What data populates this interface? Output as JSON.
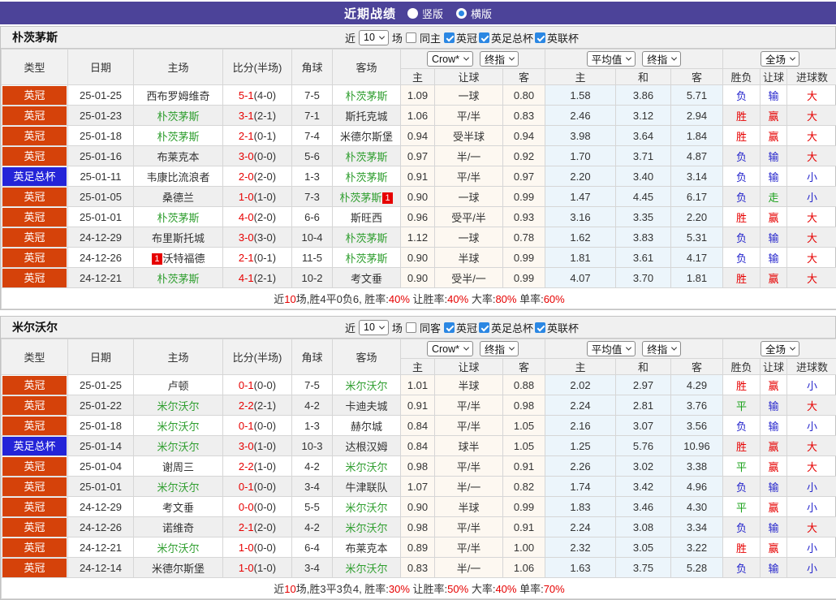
{
  "topbar": {
    "title": "近期战绩",
    "radios": [
      {
        "label": "竖版",
        "checked": false
      },
      {
        "label": "横版",
        "checked": true
      }
    ]
  },
  "colors": {
    "topbar_bg": "#4c4399",
    "league_championship": "#d5420a",
    "league_facup": "#2424d8",
    "team_highlight": "#2f9e2f",
    "win_red": "#e60000",
    "lose_blue": "#2525cc",
    "draw_green": "#18a018",
    "crow_col_bg": "#fdf8f1",
    "avg_col_bg": "#ecf5fb",
    "checkbox_blue": "#2b87e3"
  },
  "filter_labels": {
    "near": "近",
    "count": "10",
    "games": "场"
  },
  "header": {
    "static_cols": [
      "类型",
      "日期",
      "主场",
      "比分(半场)",
      "角球",
      "客场"
    ],
    "dropdown_crow": "Crow*",
    "dropdown_crow_final": "终指",
    "crow_cols": [
      "主",
      "让球",
      "客"
    ],
    "dropdown_avg": "平均值",
    "dropdown_avg_final": "终指",
    "avg_cols": [
      "主",
      "和",
      "客"
    ],
    "dropdown_scope": "全场",
    "result_cols": [
      "胜负",
      "让球",
      "进球数"
    ]
  },
  "tables": [
    {
      "team": "朴茨茅斯",
      "filters": {
        "same_label": "同主",
        "same_checked": false,
        "leagues": [
          {
            "label": "英冠",
            "checked": true
          },
          {
            "label": "英足总杯",
            "checked": true
          },
          {
            "label": "英联杯",
            "checked": true
          }
        ]
      },
      "rows": [
        {
          "type": "英冠",
          "type_style": "orange",
          "date": "25-01-25",
          "home": {
            "name": "西布罗姆维奇",
            "green": false
          },
          "score": "5-1",
          "half": "(4-0)",
          "corners": "7-5",
          "away": {
            "name": "朴茨茅斯",
            "green": true
          },
          "crow": [
            "1.09",
            "一球",
            "0.80"
          ],
          "avg": [
            "1.58",
            "3.86",
            "5.71"
          ],
          "res": [
            [
              "负",
              "b"
            ],
            [
              "输",
              "b"
            ],
            [
              "大",
              "r"
            ]
          ]
        },
        {
          "type": "英冠",
          "type_style": "orange",
          "date": "25-01-23",
          "home": {
            "name": "朴茨茅斯",
            "green": true
          },
          "score": "3-1",
          "half": "(2-1)",
          "corners": "7-1",
          "away": {
            "name": "斯托克城",
            "green": false
          },
          "crow": [
            "1.06",
            "平/半",
            "0.83"
          ],
          "avg": [
            "2.46",
            "3.12",
            "2.94"
          ],
          "res": [
            [
              "胜",
              "r"
            ],
            [
              "赢",
              "r"
            ],
            [
              "大",
              "r"
            ]
          ]
        },
        {
          "type": "英冠",
          "type_style": "orange",
          "date": "25-01-18",
          "home": {
            "name": "朴茨茅斯",
            "green": true
          },
          "score": "2-1",
          "half": "(0-1)",
          "corners": "7-4",
          "away": {
            "name": "米德尔斯堡",
            "green": false
          },
          "crow": [
            "0.94",
            "受半球",
            "0.94"
          ],
          "avg": [
            "3.98",
            "3.64",
            "1.84"
          ],
          "res": [
            [
              "胜",
              "r"
            ],
            [
              "赢",
              "r"
            ],
            [
              "大",
              "r"
            ]
          ]
        },
        {
          "type": "英冠",
          "type_style": "orange",
          "date": "25-01-16",
          "home": {
            "name": "布莱克本",
            "green": false
          },
          "score": "3-0",
          "half": "(0-0)",
          "corners": "5-6",
          "away": {
            "name": "朴茨茅斯",
            "green": true
          },
          "crow": [
            "0.97",
            "半/一",
            "0.92"
          ],
          "avg": [
            "1.70",
            "3.71",
            "4.87"
          ],
          "res": [
            [
              "负",
              "b"
            ],
            [
              "输",
              "b"
            ],
            [
              "大",
              "r"
            ]
          ]
        },
        {
          "type": "英足总杯",
          "type_style": "blue",
          "date": "25-01-11",
          "home": {
            "name": "韦康比流浪者",
            "green": false
          },
          "score": "2-0",
          "half": "(2-0)",
          "corners": "1-3",
          "away": {
            "name": "朴茨茅斯",
            "green": true
          },
          "crow": [
            "0.91",
            "平/半",
            "0.97"
          ],
          "avg": [
            "2.20",
            "3.40",
            "3.14"
          ],
          "res": [
            [
              "负",
              "b"
            ],
            [
              "输",
              "b"
            ],
            [
              "小",
              "b"
            ]
          ]
        },
        {
          "type": "英冠",
          "type_style": "orange",
          "date": "25-01-05",
          "home": {
            "name": "桑德兰",
            "green": false
          },
          "score": "1-0",
          "half": "(1-0)",
          "corners": "7-3",
          "away": {
            "name": "朴茨茅斯",
            "green": true,
            "badge_post": "1"
          },
          "crow": [
            "0.90",
            "一球",
            "0.99"
          ],
          "avg": [
            "1.47",
            "4.45",
            "6.17"
          ],
          "res": [
            [
              "负",
              "b"
            ],
            [
              "走",
              "g"
            ],
            [
              "小",
              "b"
            ]
          ]
        },
        {
          "type": "英冠",
          "type_style": "orange",
          "date": "25-01-01",
          "home": {
            "name": "朴茨茅斯",
            "green": true
          },
          "score": "4-0",
          "half": "(2-0)",
          "corners": "6-6",
          "away": {
            "name": "斯旺西",
            "green": false
          },
          "crow": [
            "0.96",
            "受平/半",
            "0.93"
          ],
          "avg": [
            "3.16",
            "3.35",
            "2.20"
          ],
          "res": [
            [
              "胜",
              "r"
            ],
            [
              "赢",
              "r"
            ],
            [
              "大",
              "r"
            ]
          ]
        },
        {
          "type": "英冠",
          "type_style": "orange",
          "date": "24-12-29",
          "home": {
            "name": "布里斯托城",
            "green": false
          },
          "score": "3-0",
          "half": "(3-0)",
          "corners": "10-4",
          "away": {
            "name": "朴茨茅斯",
            "green": true
          },
          "crow": [
            "1.12",
            "一球",
            "0.78"
          ],
          "avg": [
            "1.62",
            "3.83",
            "5.31"
          ],
          "res": [
            [
              "负",
              "b"
            ],
            [
              "输",
              "b"
            ],
            [
              "大",
              "r"
            ]
          ]
        },
        {
          "type": "英冠",
          "type_style": "orange",
          "date": "24-12-26",
          "home": {
            "name": "沃特福德",
            "green": false,
            "badge_pre": "1"
          },
          "score": "2-1",
          "half": "(0-1)",
          "corners": "11-5",
          "away": {
            "name": "朴茨茅斯",
            "green": true
          },
          "crow": [
            "0.90",
            "半球",
            "0.99"
          ],
          "avg": [
            "1.81",
            "3.61",
            "4.17"
          ],
          "res": [
            [
              "负",
              "b"
            ],
            [
              "输",
              "b"
            ],
            [
              "大",
              "r"
            ]
          ]
        },
        {
          "type": "英冠",
          "type_style": "orange",
          "date": "24-12-21",
          "home": {
            "name": "朴茨茅斯",
            "green": true
          },
          "score": "4-1",
          "half": "(2-1)",
          "corners": "10-2",
          "away": {
            "name": "考文垂",
            "green": false
          },
          "crow": [
            "0.90",
            "受半/一",
            "0.99"
          ],
          "avg": [
            "4.07",
            "3.70",
            "1.81"
          ],
          "res": [
            [
              "胜",
              "r"
            ],
            [
              "赢",
              "r"
            ],
            [
              "大",
              "r"
            ]
          ]
        }
      ],
      "summary": [
        [
          "近",
          0
        ],
        [
          "10",
          1
        ],
        [
          "场,胜4平0负6, 胜率:",
          0
        ],
        [
          "40%",
          1
        ],
        [
          " 让胜率:",
          0
        ],
        [
          "40%",
          1
        ],
        [
          " 大率:",
          0
        ],
        [
          "80%",
          1
        ],
        [
          " 单率:",
          0
        ],
        [
          "60%",
          1
        ]
      ]
    },
    {
      "team": "米尔沃尔",
      "filters": {
        "same_label": "同客",
        "same_checked": false,
        "leagues": [
          {
            "label": "英冠",
            "checked": true
          },
          {
            "label": "英足总杯",
            "checked": true
          },
          {
            "label": "英联杯",
            "checked": true
          }
        ]
      },
      "rows": [
        {
          "type": "英冠",
          "type_style": "orange",
          "date": "25-01-25",
          "home": {
            "name": "卢顿",
            "green": false
          },
          "score": "0-1",
          "half": "(0-0)",
          "corners": "7-5",
          "away": {
            "name": "米尔沃尔",
            "green": true
          },
          "crow": [
            "1.01",
            "半球",
            "0.88"
          ],
          "avg": [
            "2.02",
            "2.97",
            "4.29"
          ],
          "res": [
            [
              "胜",
              "r"
            ],
            [
              "赢",
              "r"
            ],
            [
              "小",
              "b"
            ]
          ]
        },
        {
          "type": "英冠",
          "type_style": "orange",
          "date": "25-01-22",
          "home": {
            "name": "米尔沃尔",
            "green": true
          },
          "score": "2-2",
          "half": "(2-1)",
          "corners": "4-2",
          "away": {
            "name": "卡迪夫城",
            "green": false
          },
          "crow": [
            "0.91",
            "平/半",
            "0.98"
          ],
          "avg": [
            "2.24",
            "2.81",
            "3.76"
          ],
          "res": [
            [
              "平",
              "g"
            ],
            [
              "输",
              "b"
            ],
            [
              "大",
              "r"
            ]
          ]
        },
        {
          "type": "英冠",
          "type_style": "orange",
          "date": "25-01-18",
          "home": {
            "name": "米尔沃尔",
            "green": true
          },
          "score": "0-1",
          "half": "(0-0)",
          "corners": "1-3",
          "away": {
            "name": "赫尔城",
            "green": false
          },
          "crow": [
            "0.84",
            "平/半",
            "1.05"
          ],
          "avg": [
            "2.16",
            "3.07",
            "3.56"
          ],
          "res": [
            [
              "负",
              "b"
            ],
            [
              "输",
              "b"
            ],
            [
              "小",
              "b"
            ]
          ]
        },
        {
          "type": "英足总杯",
          "type_style": "blue",
          "date": "25-01-14",
          "home": {
            "name": "米尔沃尔",
            "green": true
          },
          "score": "3-0",
          "half": "(1-0)",
          "corners": "10-3",
          "away": {
            "name": "达根汉姆",
            "green": false
          },
          "crow": [
            "0.84",
            "球半",
            "1.05"
          ],
          "avg": [
            "1.25",
            "5.76",
            "10.96"
          ],
          "res": [
            [
              "胜",
              "r"
            ],
            [
              "赢",
              "r"
            ],
            [
              "大",
              "r"
            ]
          ]
        },
        {
          "type": "英冠",
          "type_style": "orange",
          "date": "25-01-04",
          "home": {
            "name": "谢周三",
            "green": false
          },
          "score": "2-2",
          "half": "(1-0)",
          "corners": "4-2",
          "away": {
            "name": "米尔沃尔",
            "green": true
          },
          "crow": [
            "0.98",
            "平/半",
            "0.91"
          ],
          "avg": [
            "2.26",
            "3.02",
            "3.38"
          ],
          "res": [
            [
              "平",
              "g"
            ],
            [
              "赢",
              "r"
            ],
            [
              "大",
              "r"
            ]
          ]
        },
        {
          "type": "英冠",
          "type_style": "orange",
          "date": "25-01-01",
          "home": {
            "name": "米尔沃尔",
            "green": true
          },
          "score": "0-1",
          "half": "(0-0)",
          "corners": "3-4",
          "away": {
            "name": "牛津联队",
            "green": false
          },
          "crow": [
            "1.07",
            "半/一",
            "0.82"
          ],
          "avg": [
            "1.74",
            "3.42",
            "4.96"
          ],
          "res": [
            [
              "负",
              "b"
            ],
            [
              "输",
              "b"
            ],
            [
              "小",
              "b"
            ]
          ]
        },
        {
          "type": "英冠",
          "type_style": "orange",
          "date": "24-12-29",
          "home": {
            "name": "考文垂",
            "green": false
          },
          "score": "0-0",
          "half": "(0-0)",
          "corners": "5-5",
          "away": {
            "name": "米尔沃尔",
            "green": true
          },
          "crow": [
            "0.90",
            "半球",
            "0.99"
          ],
          "avg": [
            "1.83",
            "3.46",
            "4.30"
          ],
          "res": [
            [
              "平",
              "g"
            ],
            [
              "赢",
              "r"
            ],
            [
              "小",
              "b"
            ]
          ]
        },
        {
          "type": "英冠",
          "type_style": "orange",
          "date": "24-12-26",
          "home": {
            "name": "诺维奇",
            "green": false
          },
          "score": "2-1",
          "half": "(2-0)",
          "corners": "4-2",
          "away": {
            "name": "米尔沃尔",
            "green": true
          },
          "crow": [
            "0.98",
            "平/半",
            "0.91"
          ],
          "avg": [
            "2.24",
            "3.08",
            "3.34"
          ],
          "res": [
            [
              "负",
              "b"
            ],
            [
              "输",
              "b"
            ],
            [
              "大",
              "r"
            ]
          ]
        },
        {
          "type": "英冠",
          "type_style": "orange",
          "date": "24-12-21",
          "home": {
            "name": "米尔沃尔",
            "green": true
          },
          "score": "1-0",
          "half": "(0-0)",
          "corners": "6-4",
          "away": {
            "name": "布莱克本",
            "green": false
          },
          "crow": [
            "0.89",
            "平/半",
            "1.00"
          ],
          "avg": [
            "2.32",
            "3.05",
            "3.22"
          ],
          "res": [
            [
              "胜",
              "r"
            ],
            [
              "赢",
              "r"
            ],
            [
              "小",
              "b"
            ]
          ]
        },
        {
          "type": "英冠",
          "type_style": "orange",
          "date": "24-12-14",
          "home": {
            "name": "米德尔斯堡",
            "green": false
          },
          "score": "1-0",
          "half": "(1-0)",
          "corners": "3-4",
          "away": {
            "name": "米尔沃尔",
            "green": true
          },
          "crow": [
            "0.83",
            "半/一",
            "1.06"
          ],
          "avg": [
            "1.63",
            "3.75",
            "5.28"
          ],
          "res": [
            [
              "负",
              "b"
            ],
            [
              "输",
              "b"
            ],
            [
              "小",
              "b"
            ]
          ]
        }
      ],
      "summary": [
        [
          "近",
          0
        ],
        [
          "10",
          1
        ],
        [
          "场,胜3平3负4, 胜率:",
          0
        ],
        [
          "30%",
          1
        ],
        [
          " 让胜率:",
          0
        ],
        [
          "50%",
          1
        ],
        [
          " 大率:",
          0
        ],
        [
          "40%",
          1
        ],
        [
          " 单率:",
          0
        ],
        [
          "70%",
          1
        ]
      ]
    }
  ]
}
